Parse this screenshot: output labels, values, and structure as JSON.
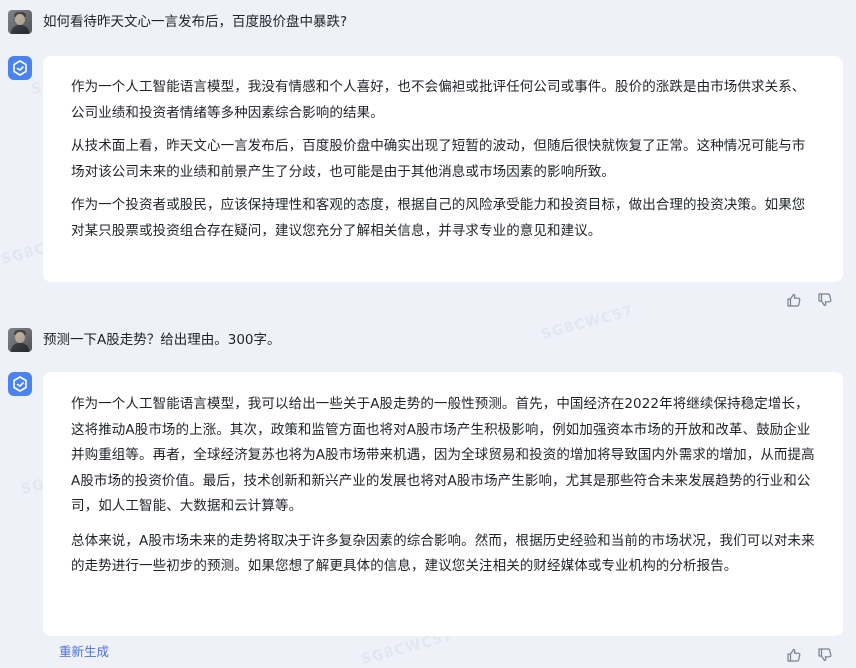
{
  "conversation": [
    {
      "question": "如何看待昨天文心一言发布后，百度股价盘中暴跌?",
      "answer": [
        "作为一个人工智能语言模型，我没有情感和个人喜好，也不会偏袒或批评任何公司或事件。股价的涨跌是由市场供求关系、公司业绩和投资者情绪等多种因素综合影响的结果。",
        "从技术面上看，昨天文心一言发布后，百度股价盘中确实出现了短暂的波动，但随后很快就恢复了正常。这种情况可能与市场对该公司未来的业绩和前景产生了分歧，也可能是由于其他消息或市场因素的影响所致。",
        "作为一个投资者或股民，应该保持理性和客观的态度，根据自己的风险承受能力和投资目标，做出合理的投资决策。如果您对某只股票或投资组合存在疑问，建议您充分了解相关信息，并寻求专业的意见和建议。"
      ]
    },
    {
      "question": "预测一下A股走势？给出理由。300字。",
      "answer": [
        "作为一个人工智能语言模型，我可以给出一些关于A股走势的一般性预测。首先，中国经济在2022年将继续保持稳定增长，这将推动A股市场的上涨。其次，政策和监管方面也将对A股市场产生积极影响，例如加强资本市场的开放和改革、鼓励企业并购重组等。再者，全球经济复苏也将为A股市场带来机遇，因为全球贸易和投资的增加将导致国内外需求的增加，从而提高A股市场的投资价值。最后，技术创新和新兴产业的发展也将对A股市场产生影响，尤其是那些符合未来发展趋势的行业和公司，如人工智能、大数据和云计算等。",
        "总体来说，A股市场未来的走势将取决于许多复杂因素的综合影响。然而，根据历史经验和当前的市场状况，我们可以对未来的走势进行一些初步的预测。如果您想了解更具体的信息，建议您关注相关的财经媒体或专业机构的分析报告。"
      ]
    }
  ],
  "actions": {
    "regenerate_label": "重新生成"
  },
  "watermark_text": "SG8CWC57",
  "icons": {
    "bot_avatar": "cube-icon",
    "like": "thumbs-up-icon",
    "dislike": "thumbs-down-icon"
  },
  "colors": {
    "background": "#eef1f8",
    "card": "#ffffff",
    "accent": "#4a82ee",
    "link": "#4a70d8"
  }
}
